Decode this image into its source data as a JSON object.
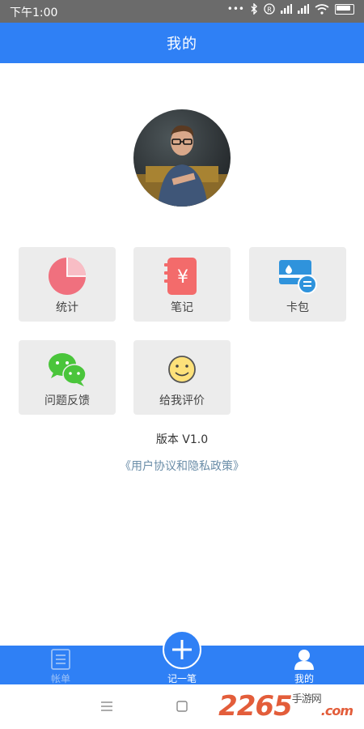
{
  "status_bar": {
    "time": "下午1:00"
  },
  "header": {
    "title": "我的"
  },
  "menu": {
    "items": [
      {
        "label": "统计",
        "icon": "pie-chart-icon"
      },
      {
        "label": "笔记",
        "icon": "notebook-icon"
      },
      {
        "label": "卡包",
        "icon": "card-wallet-icon"
      },
      {
        "label": "问题反馈",
        "icon": "wechat-icon"
      },
      {
        "label": "给我评价",
        "icon": "smiley-icon"
      }
    ]
  },
  "version": "版本 V1.0",
  "policy_link": "《用户协议和隐私政策》",
  "tabbar": {
    "bill": "帐单",
    "record": "记一笔",
    "mine": "我的"
  },
  "watermark": {
    "brand": "2265",
    "suffix": "手游网",
    "domain": ".com"
  },
  "colors": {
    "primary": "#2f80f5",
    "tile": "#ececec",
    "link": "#6a8da8"
  }
}
